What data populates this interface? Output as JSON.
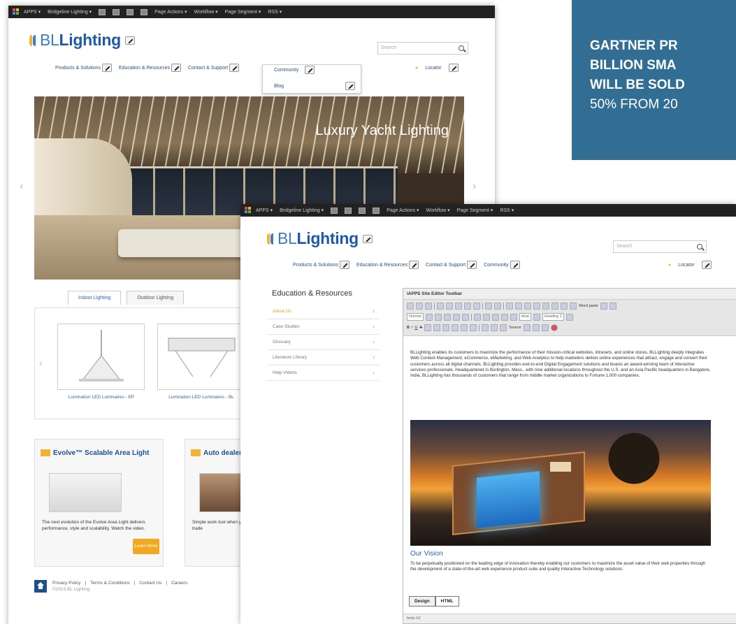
{
  "window_back": {
    "admin_bar": {
      "items": [
        "APPS ▾",
        "Bridgeline Lighting ▾",
        "Page Actions ▾",
        "Workflow ▾",
        "Page Segment ▾",
        "RSS ▾"
      ]
    },
    "logo": {
      "prefix": "BL",
      "suffix": "Lighting"
    },
    "search": {
      "placeholder": "Search"
    },
    "nav": {
      "items": [
        "Products & Solutions",
        "Education & Resources",
        "Contact & Support",
        "Community"
      ],
      "location": "Locator"
    },
    "dropdown": {
      "items": [
        "Community",
        "Blog"
      ]
    },
    "hero": {
      "title": "Luxury Yacht Lighting"
    },
    "tabs": [
      "Indoor Lighting",
      "Outdoor Lighting"
    ],
    "products": [
      {
        "label": "Lumination LED Luminaires - EP"
      },
      {
        "label": "Lumination LED Luminaires - BL"
      }
    ],
    "promos": [
      {
        "title": "Evolve™ Scalable Area Light",
        "text": "The next evolution of the Evolve Area Light delivers performance, style and scalability. Watch the video.",
        "button": "Learn More"
      },
      {
        "title": "Auto dealer",
        "text": "Simple work tool when you trade"
      }
    ],
    "footer": {
      "links": [
        "Privacy Policy",
        "|",
        "Terms & Conditions",
        "|",
        "Contact Us",
        "|",
        "Careers"
      ],
      "copyright": "©2013 BL Lighting"
    }
  },
  "window_front": {
    "admin_bar": {
      "items": [
        "APPS ▾",
        "Bridgeline Lighting ▾",
        "Page Actions ▾",
        "Workflow ▾",
        "Page Segment ▾",
        "RSS ▾"
      ]
    },
    "logo": {
      "prefix": "BL",
      "suffix": "Lighting"
    },
    "search": {
      "placeholder": "Search"
    },
    "nav": {
      "items": [
        "Products & Solutions",
        "Education & Resources",
        "Contact & Support",
        "Community"
      ],
      "location": "Locator"
    },
    "sidebar": {
      "title": "Education & Resources",
      "items": [
        "About Us",
        "Case Studies",
        "Glossary",
        "Literature Library",
        "Help Videos"
      ]
    },
    "editor": {
      "title": "iAPPS Site Editor Toolbar",
      "toolbar": {
        "format": "Normal",
        "style": "Heading 2",
        "font": "Arial",
        "source": "Source",
        "word_label": "Word paste"
      },
      "body": "BLLighting enables its customers to maximize the performance of their mission-critical websites, intranets, and online stores. BLLighting deeply integrates Web Content Management, eCommerce, eMarketing, and Web Analytics to help marketers deliver online experiences that attract, engage and convert their customers across all digital channels. BLLighting provides end-to-end Digital Engagement solutions and boasts an award-winning team of interactive services professionals. Headquartered in Burlington, Mass., with nine additional locations throughout the U.S. and an Asia Pacific headquarters in Bangalore, India, BLLighting has thousands of customers that range from middle market organizations to Fortune 1,000 companies.",
      "heading": "Our Vision",
      "vision_text": "To be perpetually positioned on the leading edge of innovation thereby enabling our customers to maximize the asset value of their web properties through the development of a state-of-the-art web experience product suite and quality Interactive Technology solutions.",
      "modes": [
        "Design",
        "HTML"
      ],
      "status": "body  h2"
    }
  },
  "callout": {
    "lines": [
      "GARTNER PR",
      "BILLION SMA",
      "WILL BE SOLD",
      "50% FROM 20"
    ]
  },
  "colors": {
    "brand_blue": "#1e5aa8",
    "callout_bg": "#326e94",
    "accent_orange": "#f2a920"
  }
}
